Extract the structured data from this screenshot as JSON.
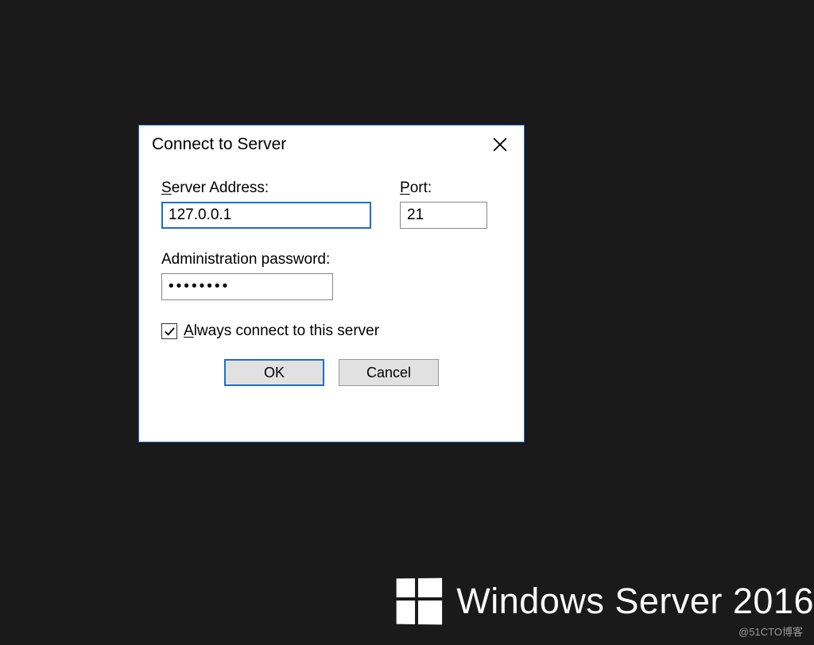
{
  "dialog": {
    "title": "Connect to Server",
    "server_label_first": "S",
    "server_label_rest": "erver Address:",
    "server_value": "127.0.0.1",
    "port_label_first": "P",
    "port_label_rest": "ort:",
    "port_value": "21",
    "password_label": "Administration password:",
    "password_value": "••••••••",
    "always_label_first": "A",
    "always_label_rest": "lways connect to this server",
    "always_checked": true,
    "ok_label": "OK",
    "cancel_label": "Cancel"
  },
  "branding": {
    "text": "Windows Server 2016"
  },
  "watermark": "@51CTO博客"
}
